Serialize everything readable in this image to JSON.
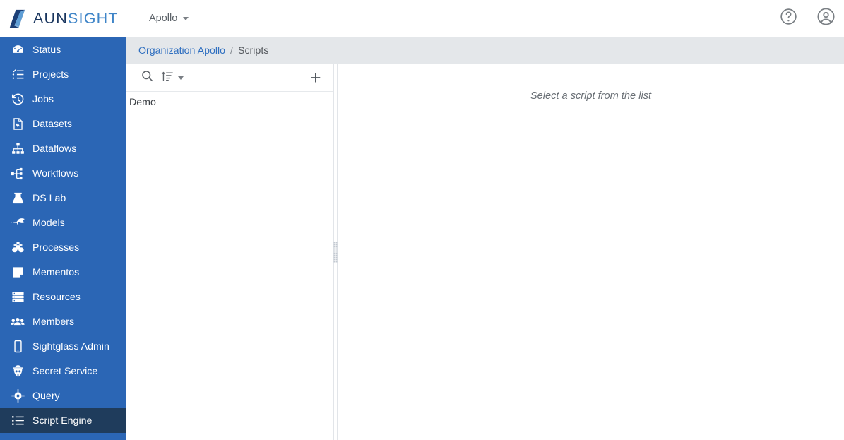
{
  "brand": {
    "name_part1": "AUN",
    "name_part2": "SIGHT",
    "logo_icon": "aunsight-diamond-logo",
    "colors": {
      "dark": "#19355e",
      "light": "#3f85c8",
      "sidebar": "#2b66b5",
      "active": "#1f3c5c",
      "link": "#2f6fc0"
    }
  },
  "header": {
    "org_label": "Apollo",
    "org_caret_icon": "chevron-down-icon",
    "help_icon": "help-circle-icon",
    "account_icon": "user-circle-icon"
  },
  "sidebar": {
    "items": [
      {
        "label": "Status",
        "icon": "speedometer-icon",
        "active": false
      },
      {
        "label": "Projects",
        "icon": "checklist-icon",
        "active": false
      },
      {
        "label": "Jobs",
        "icon": "history-clock-icon",
        "active": false
      },
      {
        "label": "Datasets",
        "icon": "document-chart-icon",
        "active": false
      },
      {
        "label": "Dataflows",
        "icon": "sitemap-icon",
        "active": false
      },
      {
        "label": "Workflows",
        "icon": "nodes-branch-icon",
        "active": false
      },
      {
        "label": "DS Lab",
        "icon": "flask-icon",
        "active": false
      },
      {
        "label": "Models",
        "icon": "rocket-icon",
        "active": false
      },
      {
        "label": "Processes",
        "icon": "cubes-icon",
        "active": false
      },
      {
        "label": "Mementos",
        "icon": "sticky-note-icon",
        "active": false
      },
      {
        "label": "Resources",
        "icon": "server-stack-icon",
        "active": false
      },
      {
        "label": "Members",
        "icon": "users-group-icon",
        "active": false
      },
      {
        "label": "Sightglass Admin",
        "icon": "mobile-device-icon",
        "active": false
      },
      {
        "label": "Secret Service",
        "icon": "spy-agent-icon",
        "active": false
      },
      {
        "label": "Query",
        "icon": "crosshair-icon",
        "active": false
      },
      {
        "label": "Script Engine",
        "icon": "list-lines-icon",
        "active": true
      }
    ]
  },
  "breadcrumb": {
    "root_label": "Organization Apollo",
    "separator": "/",
    "current_label": "Scripts"
  },
  "list_panel": {
    "toolbar": {
      "search_icon": "search-icon",
      "sort_icon": "sort-ascending-icon",
      "sort_caret_icon": "chevron-down-icon",
      "add_icon": "plus-icon",
      "add_label": "+"
    },
    "items": [
      {
        "label": "Demo"
      }
    ]
  },
  "detail_panel": {
    "empty_message": "Select a script from the list"
  },
  "splitter": {
    "name": "pane-resize-handle"
  }
}
